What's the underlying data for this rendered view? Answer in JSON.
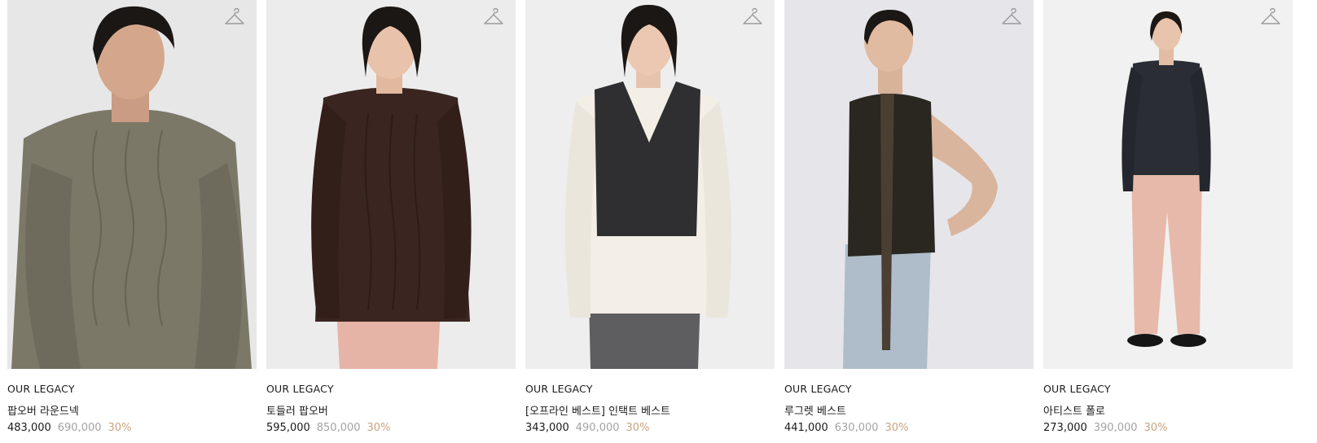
{
  "products": [
    {
      "brand": "OUR LEGACY",
      "name": "팝오버 라운드넥",
      "sale_price": "483,000",
      "original_price": "690,000",
      "discount": "30%",
      "wishlist_icon": "hanger-icon",
      "colors": {
        "bg": "#e9e9ea",
        "top": "#7c7868",
        "bottom": "#6e6a5c",
        "hair": "#1b1714"
      }
    },
    {
      "brand": "OUR LEGACY",
      "name": "토들러 팝오버",
      "sale_price": "595,000",
      "original_price": "850,000",
      "discount": "30%",
      "wishlist_icon": "hanger-icon",
      "colors": {
        "bg": "#ececed",
        "top": "#3a2520",
        "bottom": "#e5b4a6",
        "hair": "#1b1714"
      }
    },
    {
      "brand": "OUR LEGACY",
      "name": "[오프라인 베스트] 인택트 베스트",
      "sale_price": "343,000",
      "original_price": "490,000",
      "discount": "30%",
      "wishlist_icon": "hanger-icon",
      "colors": {
        "bg": "#eeeeef",
        "top": "#f3efe6",
        "vest": "#2f2f31",
        "bottom": "#5e5e60",
        "hair": "#1b1714"
      }
    },
    {
      "brand": "OUR LEGACY",
      "name": "루그렛 베스트",
      "sale_price": "441,000",
      "original_price": "630,000",
      "discount": "30%",
      "wishlist_icon": "hanger-icon",
      "colors": {
        "bg": "#e6e5ea",
        "top": "#2a2620",
        "bottom": "#aebdc9",
        "hair": "#1b1714"
      }
    },
    {
      "brand": "OUR LEGACY",
      "name": "아티스트 폴로",
      "sale_price": "273,000",
      "original_price": "390,000",
      "discount": "30%",
      "wishlist_icon": "hanger-icon",
      "colors": {
        "bg": "#f1f1f1",
        "top": "#2a2d34",
        "bottom": "#e7b9aa",
        "hair": "#1b1714"
      }
    }
  ]
}
